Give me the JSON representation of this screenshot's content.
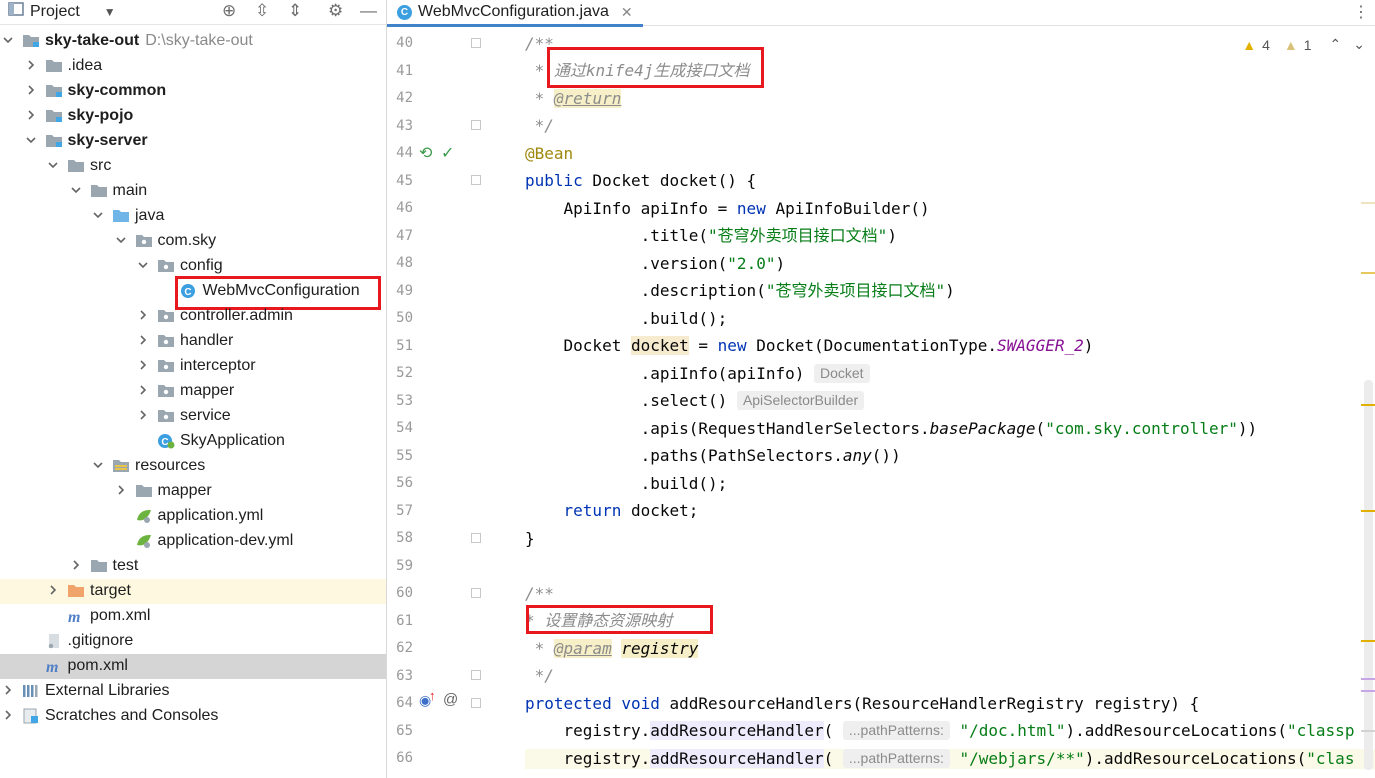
{
  "project_panel": {
    "title": "Project",
    "tree": [
      {
        "label": "sky-take-out",
        "extra": "D:\\sky-take-out",
        "bold": true,
        "depth": 0,
        "arrow": "down",
        "icon": "module-folder-icon"
      },
      {
        "label": ".idea",
        "depth": 1,
        "arrow": "right",
        "icon": "folder-icon"
      },
      {
        "label": "sky-common",
        "bold": true,
        "depth": 1,
        "arrow": "right",
        "icon": "module-folder-icon"
      },
      {
        "label": "sky-pojo",
        "bold": true,
        "depth": 1,
        "arrow": "right",
        "icon": "module-folder-icon"
      },
      {
        "label": "sky-server",
        "bold": true,
        "depth": 1,
        "arrow": "down",
        "icon": "module-folder-icon"
      },
      {
        "label": "src",
        "depth": 2,
        "arrow": "down",
        "icon": "folder-icon"
      },
      {
        "label": "main",
        "depth": 3,
        "arrow": "down",
        "icon": "folder-icon"
      },
      {
        "label": "java",
        "depth": 4,
        "arrow": "down",
        "icon": "source-folder-icon"
      },
      {
        "label": "com.sky",
        "depth": 5,
        "arrow": "down",
        "icon": "package-icon"
      },
      {
        "label": "config",
        "depth": 6,
        "arrow": "down",
        "icon": "package-icon"
      },
      {
        "label": "WebMvcConfiguration",
        "depth": 7,
        "arrow": "none",
        "icon": "class-icon",
        "boxed": true
      },
      {
        "label": "controller.admin",
        "depth": 6,
        "arrow": "right",
        "icon": "package-icon"
      },
      {
        "label": "handler",
        "depth": 6,
        "arrow": "right",
        "icon": "package-icon"
      },
      {
        "label": "interceptor",
        "depth": 6,
        "arrow": "right",
        "icon": "package-icon"
      },
      {
        "label": "mapper",
        "depth": 6,
        "arrow": "right",
        "icon": "package-icon"
      },
      {
        "label": "service",
        "depth": 6,
        "arrow": "right",
        "icon": "package-icon"
      },
      {
        "label": "SkyApplication",
        "depth": 6,
        "arrow": "none",
        "icon": "spring-class-icon"
      },
      {
        "label": "resources",
        "depth": 4,
        "arrow": "down",
        "icon": "resources-folder-icon"
      },
      {
        "label": "mapper",
        "depth": 5,
        "arrow": "right",
        "icon": "folder-icon"
      },
      {
        "label": "application.yml",
        "depth": 5,
        "arrow": "none",
        "icon": "spring-yml-icon"
      },
      {
        "label": "application-dev.yml",
        "depth": 5,
        "arrow": "none",
        "icon": "spring-yml-icon"
      },
      {
        "label": "test",
        "depth": 3,
        "arrow": "right",
        "icon": "folder-icon"
      },
      {
        "label": "target",
        "depth": 2,
        "arrow": "right",
        "icon": "target-folder-icon",
        "highlight": "yellow"
      },
      {
        "label": "pom.xml",
        "depth": 2,
        "arrow": "none",
        "icon": "maven-icon"
      },
      {
        "label": ".gitignore",
        "depth": 1,
        "arrow": "none",
        "icon": "gitignore-icon"
      },
      {
        "label": "pom.xml",
        "depth": 1,
        "arrow": "none",
        "icon": "maven-icon",
        "highlight": "gray"
      },
      {
        "label": "External Libraries",
        "depth": 0,
        "arrow": "right",
        "icon": "libraries-icon"
      },
      {
        "label": "Scratches and Consoles",
        "depth": 0,
        "arrow": "right",
        "icon": "scratches-icon"
      }
    ]
  },
  "editor": {
    "tab_label": "WebMvcConfiguration.java",
    "warnings": {
      "warn_count": "4",
      "weak_count": "1"
    },
    "line_numbers": [
      "40",
      "41",
      "42",
      "43",
      "44",
      "45",
      "46",
      "47",
      "48",
      "49",
      "50",
      "51",
      "52",
      "53",
      "54",
      "55",
      "56",
      "57",
      "58",
      "59",
      "60",
      "61",
      "62",
      "63",
      "64",
      "65",
      "66"
    ],
    "code": {
      "l40": "/**",
      "l41_star": " * ",
      "l41_text": "通过knife4j生成接口文档",
      "l42_star": " * ",
      "l42_tag": "@return",
      "l43": " */",
      "l44": "@Bean",
      "l45_kw": "public",
      "l45_rest": " Docket docket() {",
      "l46_a": "    ApiInfo apiInfo = ",
      "l46_kw": "new",
      "l46_b": " ApiInfoBuilder()",
      "l47_a": "            .title(",
      "l47_str": "\"苍穹外卖项目接口文档\"",
      "l47_b": ")",
      "l48_a": "            .version(",
      "l48_str": "\"2.0\"",
      "l48_b": ")",
      "l49_a": "            .description(",
      "l49_str": "\"苍穹外卖项目接口文档\"",
      "l49_b": ")",
      "l50": "            .build();",
      "l51_a": "    Docket ",
      "l51_var": "docket",
      "l51_b": " = ",
      "l51_kw": "new",
      "l51_c": " Docket(DocumentationType.",
      "l51_static": "SWAGGER_2",
      "l51_d": ")",
      "l52_a": "            .apiInfo(apiInfo)",
      "l52_hint": "Docket",
      "l53_a": "            .select()",
      "l53_hint": "ApiSelectorBuilder",
      "l54_a": "            .apis(RequestHandlerSelectors.",
      "l54_ital": "basePackage",
      "l54_b": "(",
      "l54_str": "\"com.sky.controller\"",
      "l54_c": "))",
      "l55_a": "            .paths(PathSelectors.",
      "l55_ital": "any",
      "l55_b": "())",
      "l56": "            .build();",
      "l57_kw": "    return",
      "l57_rest": " docket;",
      "l58": "}",
      "l60": "/**",
      "l61": "* 设置静态资源映射",
      "l62_star": " * ",
      "l62_tag": "@param",
      "l62_param": "registry",
      "l63": " */",
      "l64_kw": "protected void",
      "l64_rest": " addResourceHandlers(ResourceHandlerRegistry registry) {",
      "l65_a": "    registry.",
      "l65_method": "addResourceHandler",
      "l65_b": "( ",
      "l65_hint": "...pathPatterns:",
      "l65_str": "\"/doc.html\"",
      "l65_c": ").addResourceLocations(",
      "l65_str2": "\"classp",
      "l66_a": "    registry.",
      "l66_method": "addResourceHandler",
      "l66_b": "( ",
      "l66_hint": "...pathPatterns:",
      "l66_str": "\"/webjars/**\"",
      "l66_c": ").addResourceLocations(",
      "l66_str2": "\"clas"
    }
  },
  "colors": {
    "keyword": "#0033b3",
    "string": "#067d17",
    "comment": "#8c8c8c",
    "annotation": "#9e880d",
    "static_field": "#871094",
    "annotation_box": "#e8191e"
  }
}
